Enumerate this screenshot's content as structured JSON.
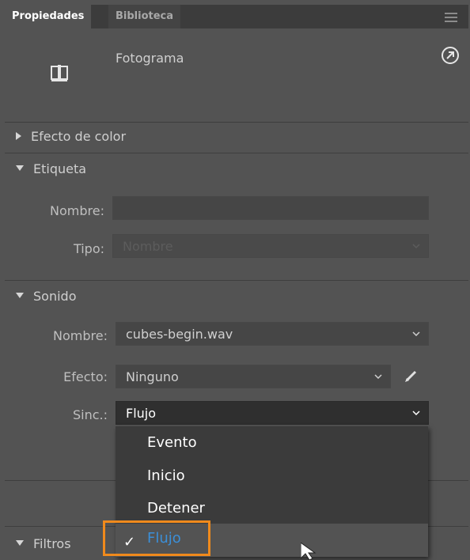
{
  "tabs": {
    "active": "Propiedades",
    "inactive": "Biblioteca"
  },
  "header": {
    "title": "Fotograma",
    "frame_icon": "frame-icon",
    "goto_icon": "go-to-icon"
  },
  "sections": {
    "color_effect": {
      "title": "Efecto de color",
      "expanded": false
    },
    "label": {
      "title": "Etiqueta",
      "expanded": true,
      "name_label": "Nombre:",
      "name_value": "",
      "type_label": "Tipo:",
      "type_value": "Nombre"
    },
    "sound": {
      "title": "Sonido",
      "expanded": true,
      "name_label": "Nombre:",
      "name_value": "cubes-begin.wav",
      "effect_label": "Efecto:",
      "effect_value": "Ninguno",
      "sync_label": "Sinc.:",
      "sync_value": "Flujo"
    },
    "filters": {
      "title": "Filtros",
      "expanded": true
    }
  },
  "sync_dropdown": {
    "options": [
      "Evento",
      "Inicio",
      "Detener",
      "Flujo"
    ],
    "selected": "Flujo",
    "check": "✓"
  },
  "colors": {
    "accent": "#3b8fd8",
    "highlight": "#f08a1c"
  }
}
